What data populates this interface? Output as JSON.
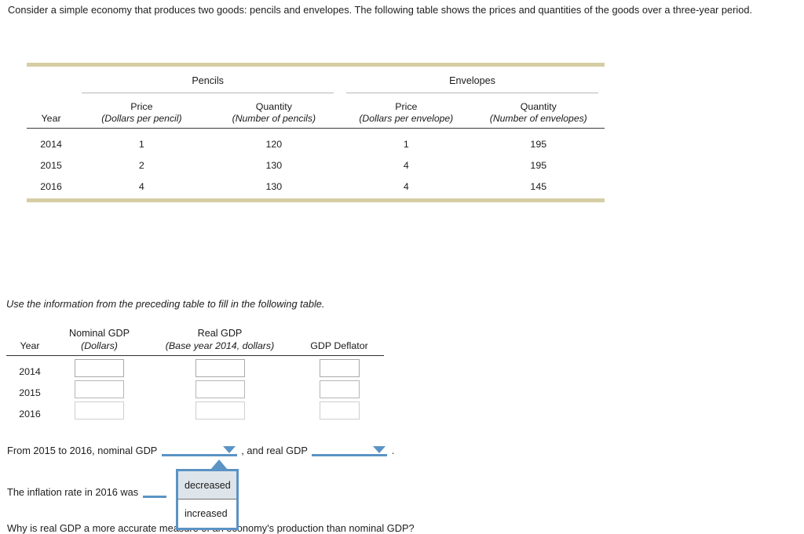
{
  "intro": {
    "text": "Consider a simple economy that produces two goods: pencils and envelopes. The following table shows the prices and quantities of the goods over a three-year period."
  },
  "table1": {
    "group_headers": [
      "Pencils",
      "Envelopes"
    ],
    "year_header": "Year",
    "sub_headers": [
      "Price",
      "Quantity",
      "Price",
      "Quantity"
    ],
    "sub_units": [
      "(Dollars per pencil)",
      "(Number of pencils)",
      "(Dollars per envelope)",
      "(Number of envelopes)"
    ],
    "rows": [
      {
        "year": "2014",
        "pencil_price": "1",
        "pencil_qty": "120",
        "envelope_price": "1",
        "envelope_qty": "195"
      },
      {
        "year": "2015",
        "pencil_price": "2",
        "pencil_qty": "130",
        "envelope_price": "4",
        "envelope_qty": "195"
      },
      {
        "year": "2016",
        "pencil_price": "4",
        "pencil_qty": "130",
        "envelope_price": "4",
        "envelope_qty": "145"
      }
    ],
    "border_color": "#d6cda4"
  },
  "instruction": {
    "text": "Use the information from the preceding table to fill in the following table."
  },
  "table2": {
    "year_header": "Year",
    "top_headers": [
      "Nominal GDP",
      "Real GDP"
    ],
    "sub_headers": [
      "(Dollars)",
      "(Base year 2014, dollars)",
      "GDP Deflator"
    ],
    "rows": [
      {
        "year": "2014",
        "nominal_gdp": "",
        "real_gdp": "",
        "gdp_deflator": ""
      },
      {
        "year": "2015",
        "nominal_gdp": "",
        "real_gdp": "",
        "gdp_deflator": ""
      },
      {
        "year": "2016",
        "nominal_gdp": "",
        "real_gdp": "",
        "gdp_deflator": ""
      }
    ]
  },
  "sentence1": {
    "prefix": "From 2015 to 2016, nominal GDP",
    "middle": ", and real GDP",
    "suffix": ".",
    "dropdown1_value": "",
    "dropdown2_value": ""
  },
  "sentence2": {
    "prefix": "The inflation rate in 2016 was",
    "dropdown_value": ""
  },
  "sentence3": {
    "text": "Why is real GDP a more accurate measure of an economy's production than nominal GDP?"
  },
  "dropdown_menu": {
    "options": [
      "decreased",
      "increased"
    ],
    "selected": "decreased",
    "accent_color": "#5b93c4",
    "highlight_color": "#dde5ea"
  }
}
